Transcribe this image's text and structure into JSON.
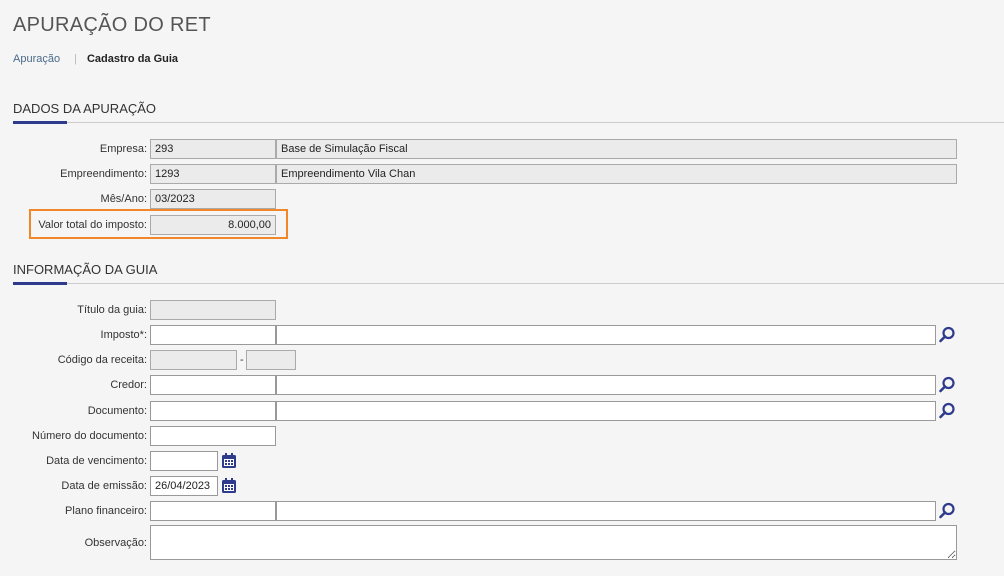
{
  "page": {
    "title": "APURAÇÃO DO RET"
  },
  "breadcrumb": {
    "link": "Apuração",
    "current": "Cadastro da Guia"
  },
  "dados": {
    "section_title": "DADOS DA APURAÇÃO",
    "empresa": {
      "label": "Empresa:",
      "code": "293",
      "name": "Base de Simulação Fiscal"
    },
    "empreendimento": {
      "label": "Empreendimento:",
      "code": "1293",
      "name": "Empreendimento Vila Chan"
    },
    "mes_ano": {
      "label": "Mês/Ano:",
      "value": "03/2023"
    },
    "valor_total": {
      "label": "Valor total do imposto:",
      "value": "8.000,00"
    }
  },
  "guia": {
    "section_title": "INFORMAÇÃO DA GUIA",
    "titulo": {
      "label": "Título da guia:",
      "value": ""
    },
    "imposto": {
      "label": "Imposto*:",
      "code": "",
      "name": ""
    },
    "codigo_receita": {
      "label": "Código da receita:",
      "part1": "",
      "separator": "-",
      "part2": ""
    },
    "credor": {
      "label": "Credor:",
      "code": "",
      "name": ""
    },
    "documento": {
      "label": "Documento:",
      "code": "",
      "name": ""
    },
    "numero_documento": {
      "label": "Número do documento:",
      "value": ""
    },
    "data_vencimento": {
      "label": "Data de vencimento:",
      "value": ""
    },
    "data_emissao": {
      "label": "Data de emissão:",
      "value": "26/04/2023"
    },
    "plano_financeiro": {
      "label": "Plano financeiro:",
      "code": "",
      "name": ""
    },
    "observacao": {
      "label": "Observação:",
      "value": ""
    }
  },
  "icons": {
    "search": "search-icon",
    "calendar": "calendar-icon"
  },
  "colors": {
    "accent": "#2e3a8c",
    "highlight": "#f0882a",
    "icon": "#2e3a8c"
  }
}
